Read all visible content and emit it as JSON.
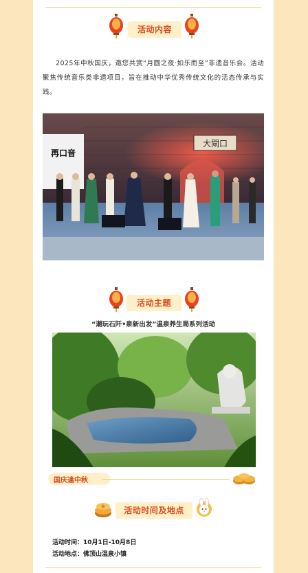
{
  "section_intro": {
    "title": "活动内容",
    "body": "2025年中秋国庆，邀您共赏“月圆之夜·如乐而至”非遗音乐会。活动聚焦传统音乐类非遗项目，旨在推动中华优秀传统文化的活态传承与实践。"
  },
  "stage_photo": {
    "sign_text": "大閘口",
    "screen_text": "再口音"
  },
  "section_theme": {
    "title": "活动主题",
    "subtitle": "“潮玩石阡•泉新出发”温泉养生局系列活动"
  },
  "tag": {
    "label": "国庆逢中秋"
  },
  "section_time": {
    "title": "活动时间及地点",
    "time_label": "活动时间：",
    "time_value": "10月1日-10月8日",
    "place_label": "活动地点：",
    "place_value": "佛顶山温泉小镇"
  },
  "colors": {
    "page_bg": "#fbe6bd",
    "accent": "#d84b1e",
    "pill_bg": "#fff0c9",
    "rule": "#f0c878"
  },
  "icons": [
    "lantern-icon",
    "mooncake-icon",
    "rabbit-icon"
  ]
}
